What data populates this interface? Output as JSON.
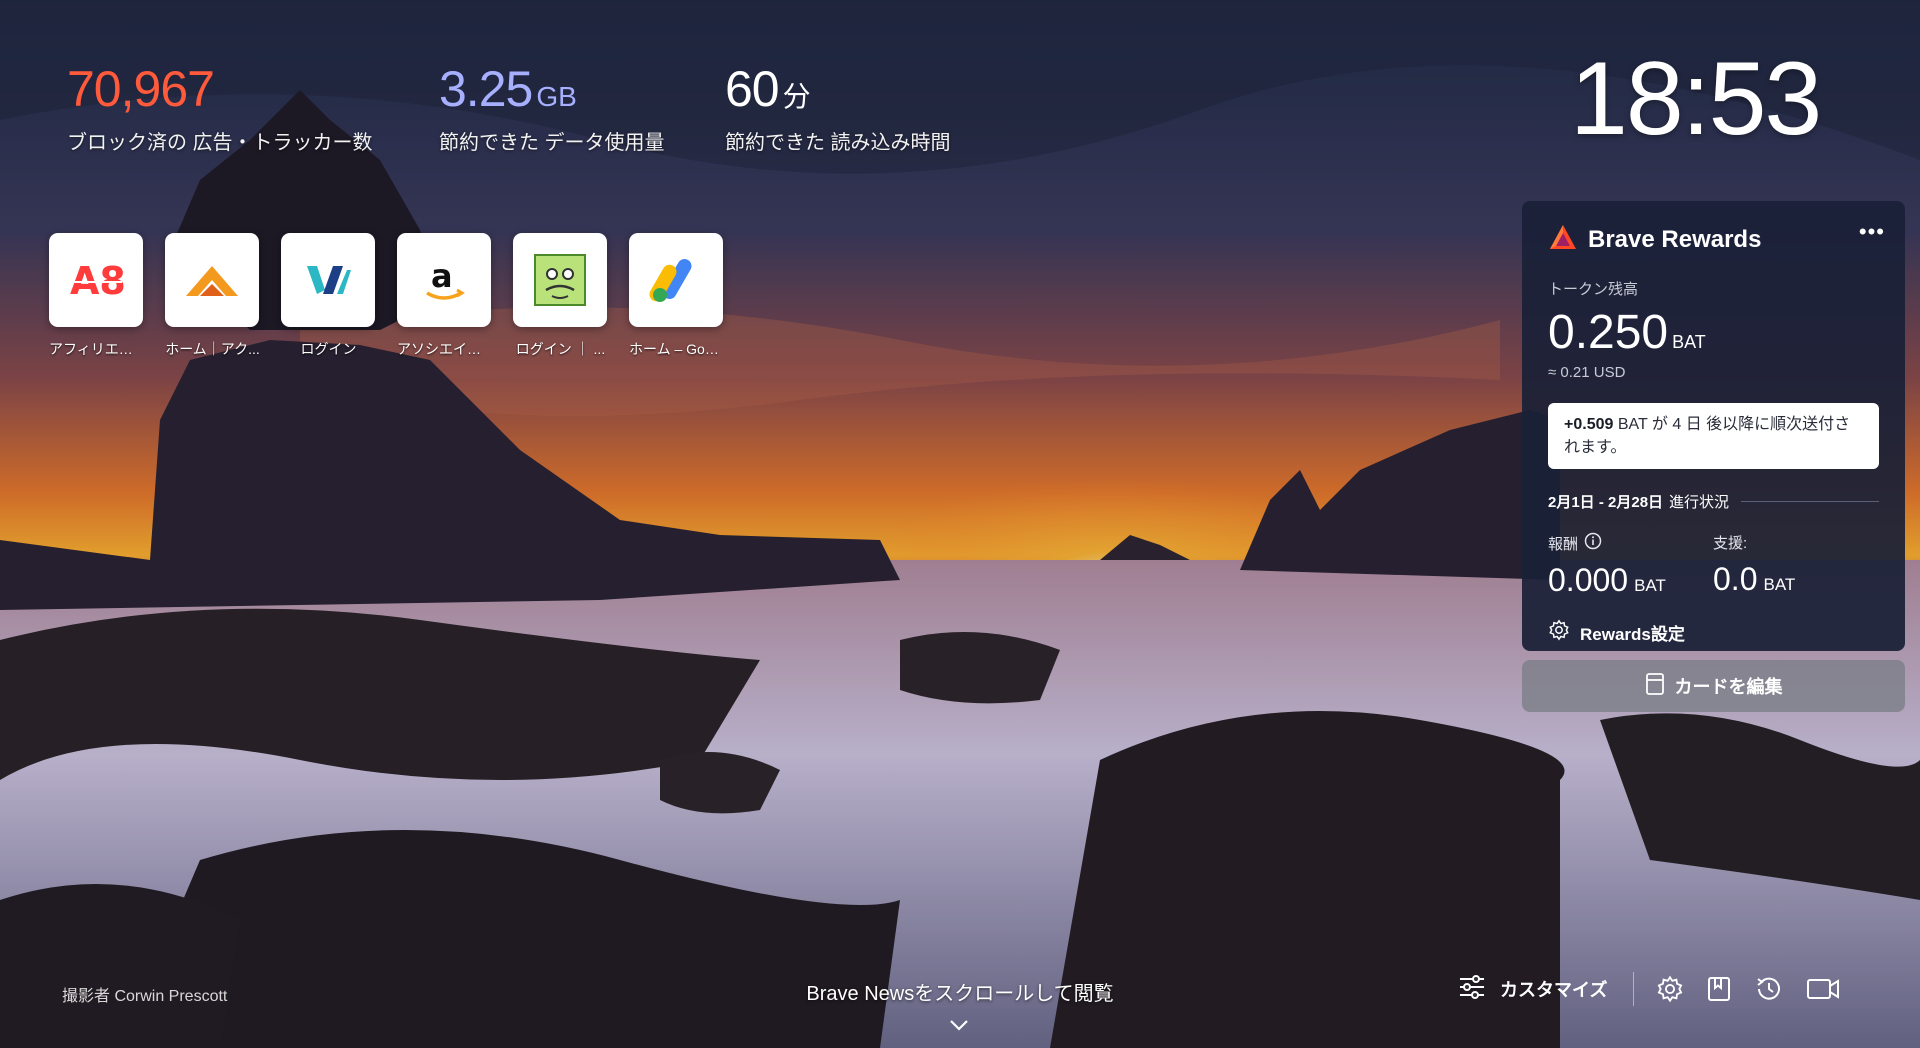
{
  "stats": {
    "ads": {
      "value": "70,967",
      "label": "ブロック済の 広告・トラッカー数"
    },
    "data": {
      "value": "3.25",
      "unit": "GB",
      "label": "節約できた データ使用量"
    },
    "time": {
      "value": "60",
      "unit": "分",
      "label": "節約できた 読み込み時間"
    }
  },
  "clock": "18:53",
  "top_sites": [
    {
      "label": "アフィリエイ...",
      "icon": "a8-logo-icon"
    },
    {
      "label": "ホーム｜アク...",
      "icon": "accesstrade-logo-icon"
    },
    {
      "label": "ログイン",
      "icon": "valuecommerce-logo-icon"
    },
    {
      "label": "アソシエイト...",
      "icon": "amazon-logo-icon"
    },
    {
      "label": "ログイン ｜ ...",
      "icon": "moshimo-logo-icon"
    },
    {
      "label": "ホーム – Goo...",
      "icon": "google-ads-logo-icon"
    }
  ],
  "rewards": {
    "title": "Brave Rewards",
    "more": "•••",
    "balance_label": "トークン残高",
    "balance": "0.250",
    "balance_unit": "BAT",
    "usd": "≈ 0.21 USD",
    "notice_amount": "+0.509",
    "notice_text": " BAT が 4 日 後以降に順次送付されます。",
    "period_dates": "2月1日 - 2月28日",
    "period_label": "進行状況",
    "earned_label": "報酬",
    "earned_value": "0.000",
    "earned_unit": "BAT",
    "tips_label": "支援:",
    "tips_value": "0.0",
    "tips_unit": "BAT",
    "settings_label": "Rewards設定"
  },
  "edit_cards_label": "カードを編集",
  "photo_credit": "撮影者 Corwin Prescott",
  "news_prompt": "Brave Newsをスクロールして閲覧",
  "customize_label": "カスタマイズ",
  "colors": {
    "ads_accent": "#ff5a3c",
    "data_accent": "#a6b0ff",
    "card_bg": "#1a2037"
  }
}
